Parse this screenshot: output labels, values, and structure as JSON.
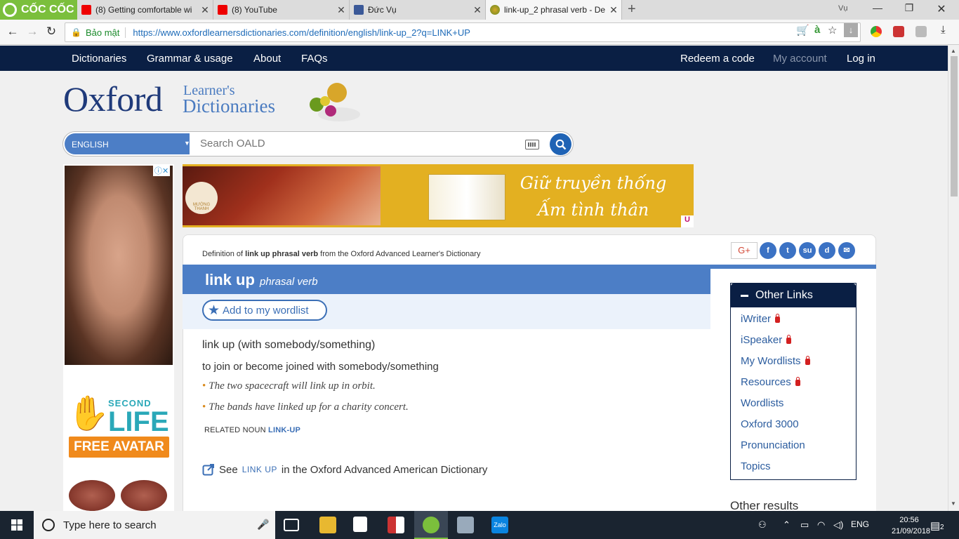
{
  "browser": {
    "brand": "CỐC CỐC",
    "tabs": [
      {
        "label": "(8) Getting comfortable wi",
        "icon": "youtube-icon"
      },
      {
        "label": "(8) YouTube",
        "icon": "youtube-icon"
      },
      {
        "label": "Đức Vụ",
        "icon": "facebook-icon"
      },
      {
        "label": "link-up_2 phrasal verb - De",
        "icon": "oxford-icon"
      }
    ],
    "user": "Vụ",
    "secure_label": "Bảo mật",
    "url": "https://www.oxfordlearnersdictionaries.com/definition/english/link-up_2?q=LINK+UP"
  },
  "sitenav": {
    "left": [
      "Dictionaries",
      "Grammar & usage",
      "About",
      "FAQs"
    ],
    "redeem": "Redeem a code",
    "account": "My account",
    "login": "Log in"
  },
  "logo": {
    "oxford": "Oxford",
    "learners": "Learner's",
    "dictionaries": "Dictionaries"
  },
  "search": {
    "language": "ENGLISH",
    "placeholder": "Search OALD"
  },
  "ads": {
    "left": {
      "second": "SECOND",
      "life": "LIFE",
      "cta": "FREE AVATAR ≫"
    },
    "banner": {
      "brand": "MƯỜNG THANH",
      "slogan_line1": "Giữ truyền thống",
      "slogan_line2": "Ấm tình thân",
      "badge": "U"
    }
  },
  "entry": {
    "definition_of_prefix": "Definition of ",
    "definition_of_bold": "link up phrasal verb",
    "definition_of_suffix": " from the Oxford Advanced Learner's Dictionary",
    "headword": "link up",
    "pos": "phrasal verb",
    "add_wordlist": "Add to my wordlist",
    "phrase": "link up (with somebody/something)",
    "definition": "to join or become joined with somebody/something",
    "examples": [
      "The two spacecraft will link up in orbit.",
      "The bands have linked up for a charity concert."
    ],
    "related_label": "RELATED NOUN",
    "related_link": "LINK-UP",
    "see_prefix": "See",
    "see_link": "LINK UP",
    "see_suffix": "in the Oxford Advanced American Dictionary"
  },
  "share": {
    "gplus": "G+",
    "icons": [
      "facebook-icon",
      "twitter-icon",
      "stumbleupon-icon",
      "delicious-icon",
      "email-icon"
    ]
  },
  "other_links": {
    "title": "Other Links",
    "items": [
      {
        "label": "iWriter",
        "locked": true
      },
      {
        "label": "iSpeaker",
        "locked": true
      },
      {
        "label": "My Wordlists",
        "locked": true
      },
      {
        "label": "Resources",
        "locked": true
      },
      {
        "label": "Wordlists",
        "locked": false
      },
      {
        "label": "Oxford 3000",
        "locked": false
      },
      {
        "label": "Pronunciation",
        "locked": false
      },
      {
        "label": "Topics",
        "locked": false
      }
    ]
  },
  "other_results": "Other results",
  "taskbar": {
    "search_placeholder": "Type here to search",
    "language": "ENG",
    "time": "20:56",
    "date": "21/09/2018",
    "notifications": "2"
  },
  "colors": {
    "nav_bg": "#0a1f44",
    "accent_blue": "#4c7ec6",
    "link_blue": "#2c5d9f",
    "bullet_orange": "#d98a1c",
    "coccoc_green": "#7bbf3c"
  }
}
